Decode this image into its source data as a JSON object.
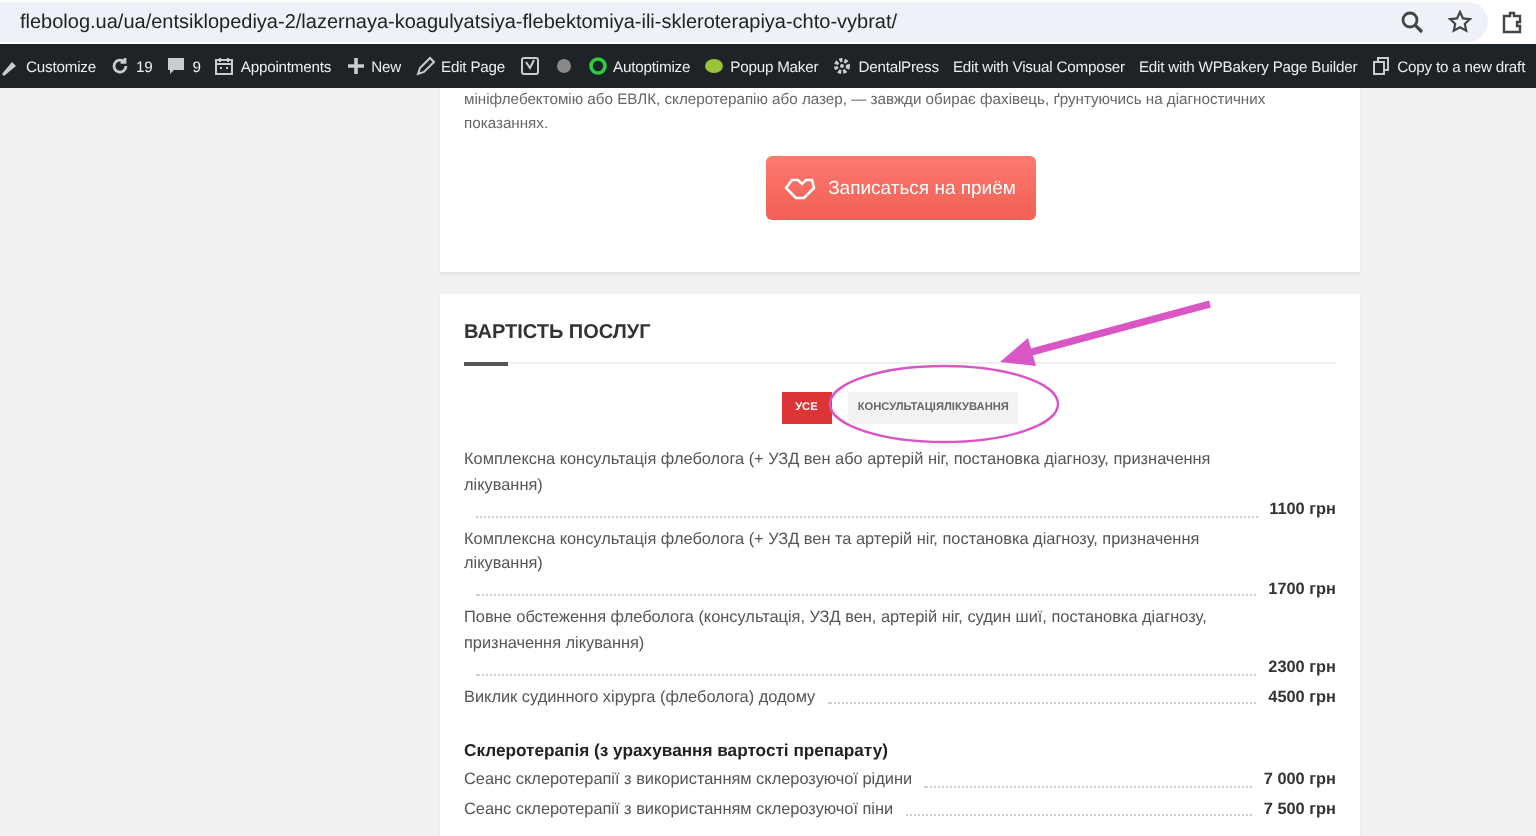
{
  "browser": {
    "url": "flebolog.ua/ua/entsiklopediya-2/lazernaya-koagulyatsiya-flebektomiya-ili-skleroterapiya-chto-vybrat/"
  },
  "admin_bar": {
    "items": [
      {
        "kind": "brush",
        "label": "Customize"
      },
      {
        "kind": "refresh",
        "label": "19"
      },
      {
        "kind": "comment",
        "label": "9"
      },
      {
        "kind": "calendar",
        "label": "Appointments"
      },
      {
        "kind": "plus",
        "label": "New"
      },
      {
        "kind": "pencil",
        "label": "Edit Page"
      },
      {
        "kind": "seo"
      },
      {
        "kind": "dot"
      },
      {
        "kind": "ring",
        "label": "Autoptimize"
      },
      {
        "kind": "popup",
        "label": "Popup Maker"
      },
      {
        "kind": "gear",
        "label": "DentalPress"
      },
      {
        "kind": "none",
        "label": "Edit with Visual Composer"
      },
      {
        "kind": "none",
        "label": "Edit with WPBakery Page Builder"
      },
      {
        "kind": "copy",
        "label": "Copy to a new draft"
      }
    ]
  },
  "intro": {
    "paragraph": [
      "мініфлебектомію або ЕВЛК, склеротерапію або лазер, — завжди обирає фахівець, ґрунтуючись на діагностичних",
      "показаннях."
    ],
    "button": "Записаться на приём"
  },
  "prices": {
    "title": "ВАРТІСТЬ ПОСЛУГ",
    "tabs": [
      {
        "label": "УСЕ",
        "selected": true
      },
      {
        "label": "КОНСУЛЬТАЦІЯЛІКУВАННЯ",
        "selected": false
      }
    ],
    "sections": [
      {
        "rows": [
          {
            "name": "Комплексна консультація флеболога (+ УЗД вен або артерій ніг, постановка діагнозу, призначення лікування)",
            "price": "1100 грн"
          },
          {
            "name": "Комплексна консультація флеболога (+ УЗД вен та артерій ніг, постановка діагнозу, призначення лікування)",
            "price": "1700 грн"
          },
          {
            "name": "Повне обстеження флеболога (консультація, УЗД вен, артерій ніг, судин шиї, постановка діагнозу, призначення лікування)",
            "price": "2300 грн"
          },
          {
            "name": "Виклик судинного хірурга (флеболога) додому",
            "price": "4500 грн"
          }
        ]
      },
      {
        "heading": "Склеротерапія (з урахування вартості препарату)",
        "rows": [
          {
            "name": "Сеанс склеротерапії з використанням склерозуючої рідини",
            "price": "7 000 грн"
          },
          {
            "name": "Сеанс склеротерапії з використанням склерозуючої піни",
            "price": "7 500 грн"
          }
        ]
      }
    ]
  }
}
